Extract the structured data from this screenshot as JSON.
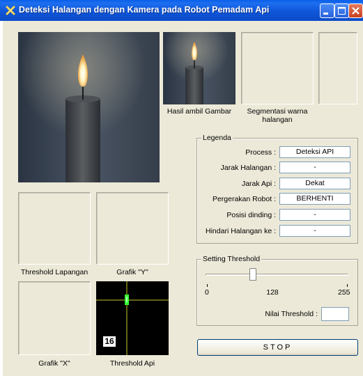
{
  "window": {
    "title": "Deteksi Halangan dengan Kamera pada Robot Pemadam Api",
    "buttons": [
      "minimize",
      "maximize",
      "close"
    ]
  },
  "images": {
    "hasil_caption": "Hasil ambil Gambar",
    "segmentasi_caption": "Segmentasi warna halangan",
    "threshold_lapangan_caption": "Threshold Lapangan",
    "grafik_y_caption": "Grafik \"Y\"",
    "grafik_x_caption": "Grafik \"X\"",
    "threshold_api_caption": "Threshold Api",
    "threshold_api_count": "16"
  },
  "legenda": {
    "title": "Legenda",
    "rows": [
      {
        "label": "Process :",
        "value": "Deteksi API"
      },
      {
        "label": "Jarak Halangan :",
        "value": "-"
      },
      {
        "label": "Jarak Api :",
        "value": "Dekat"
      },
      {
        "label": "Pergerakan Robot :",
        "value": "BERHENTI"
      },
      {
        "label": "Posisi dinding :",
        "value": "-"
      },
      {
        "label": "Hindari Halangan ke :",
        "value": "-"
      }
    ]
  },
  "threshold": {
    "title": "Setting Threshold",
    "min_label": "0",
    "mid_label": "128",
    "max_label": "255",
    "slider_fraction": 0.33,
    "value_label": "Nilai Threshold :",
    "value": ""
  },
  "stop_button": {
    "label": "STOP"
  },
  "colors": {
    "titlebar": "#0b4bc9",
    "background": "#ece9d8",
    "crosshair": "#c8c828",
    "blob": "#33ff33"
  }
}
